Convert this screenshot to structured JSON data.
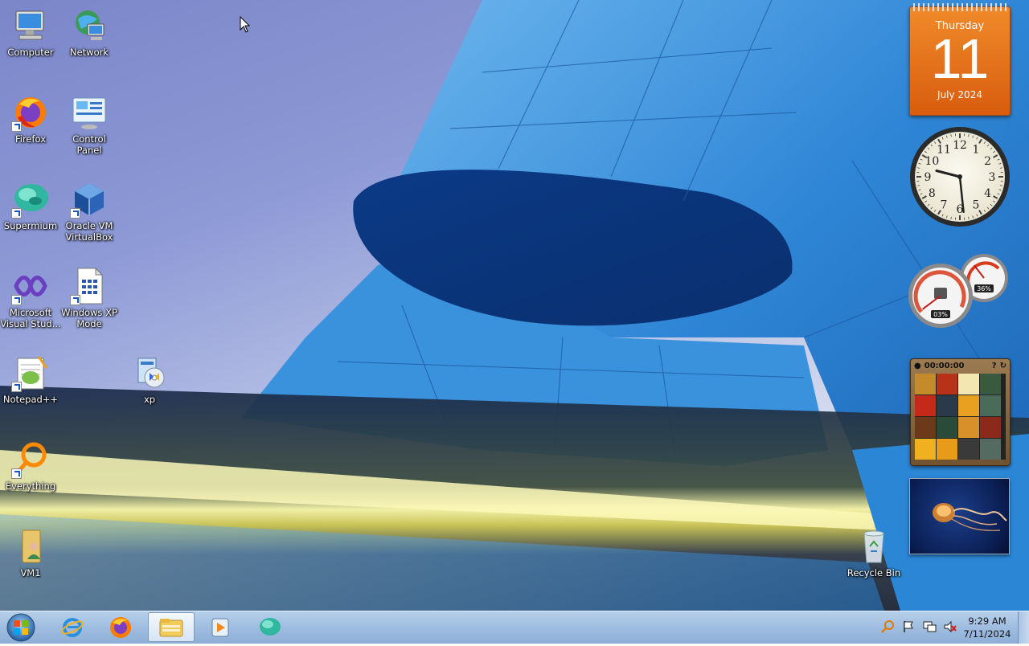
{
  "desktop": {
    "icons": [
      {
        "label": "Computer"
      },
      {
        "label": "Network"
      },
      {
        "label": "Firefox"
      },
      {
        "label": "Control Panel"
      },
      {
        "label": "Supermium"
      },
      {
        "label": "Oracle VM VirtualBox"
      },
      {
        "label": "Microsoft Visual Stud..."
      },
      {
        "label": "Windows XP Mode"
      },
      {
        "label": "Notepad++"
      },
      {
        "label": "xp"
      },
      {
        "label": "Everything"
      },
      {
        "label": "VM1"
      },
      {
        "label": "Recycle Bin"
      }
    ]
  },
  "gadgets": {
    "calendar": {
      "weekday": "Thursday",
      "day": "11",
      "month_year": "July 2024"
    },
    "clock": {
      "hours": 9,
      "minutes": 29,
      "numerals": [
        "12",
        "1",
        "2",
        "3",
        "4",
        "5",
        "6",
        "7",
        "8",
        "9",
        "10",
        "11"
      ]
    },
    "cpu_meter": {
      "cpu_label": "03%",
      "memory_label": "36%",
      "cpu": 3,
      "memory": 36
    },
    "puzzle": {
      "timer": "00:00:00"
    },
    "slideshow": {
      "subject": "jellyfish"
    }
  },
  "taskbar": {
    "start_icon": "windows-orb-icon",
    "pinned": [
      {
        "name": "internet-explorer",
        "icon": "ie-icon"
      },
      {
        "name": "firefox",
        "icon": "firefox-icon"
      },
      {
        "name": "windows-explorer",
        "icon": "folder-icon",
        "active": true
      },
      {
        "name": "windows-media-player",
        "icon": "media-player-icon"
      },
      {
        "name": "supermium",
        "icon": "supermium-icon"
      }
    ],
    "tray_icons": [
      "everything-search-icon",
      "action-center-flag-icon",
      "network-icon",
      "volume-muted-icon"
    ],
    "time": "9:29 AM",
    "date": "7/11/2024"
  },
  "colors": {
    "taskbar": "#9fbde0",
    "calendar": "#e8741c",
    "wallpaper_blue": "#2a7fd0"
  }
}
